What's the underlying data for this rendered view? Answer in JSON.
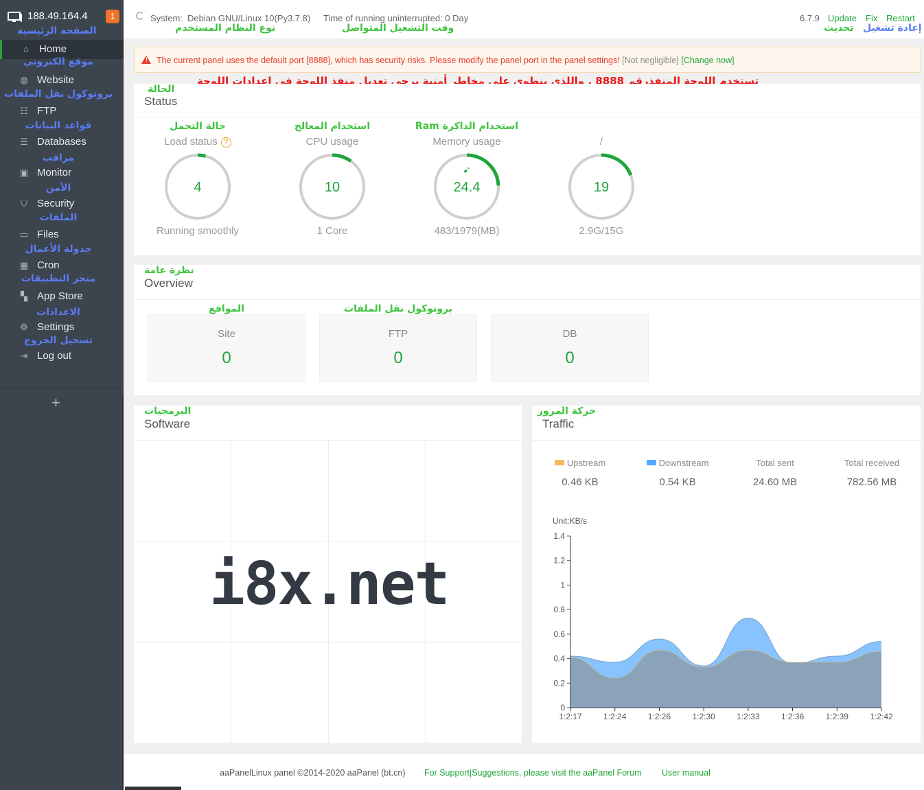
{
  "sidebar": {
    "ip": "188.49.164.4",
    "badge": "1",
    "home_ar": "الصفحة الرئيسية",
    "items": [
      {
        "label": "Home",
        "ar": "موقع الكتروني",
        "icon": "home-icon"
      },
      {
        "label": "Website",
        "ar": "بروتوكول نقل الملفات",
        "icon": "globe-icon"
      },
      {
        "label": "FTP",
        "ar": "قواعد البيانات",
        "icon": "ftp-icon"
      },
      {
        "label": "Databases",
        "ar": "مراقب",
        "icon": "database-icon"
      },
      {
        "label": "Monitor",
        "ar": "الأمن",
        "icon": "monitor-icon"
      },
      {
        "label": "Security",
        "ar": "الملفات",
        "icon": "shield-icon"
      },
      {
        "label": "Files",
        "ar": "جدولة الأعمال",
        "icon": "folder-icon"
      },
      {
        "label": "Cron",
        "ar": "متجر التطبيقات",
        "icon": "calendar-icon"
      },
      {
        "label": "App Store",
        "ar": "الاعدادات",
        "icon": "grid-icon"
      },
      {
        "label": "Settings",
        "ar": "تسجيل الخروج",
        "icon": "gear-icon"
      },
      {
        "label": "Log out",
        "ar": "",
        "icon": "logout-icon"
      }
    ],
    "add": "+"
  },
  "topbar": {
    "system_label": "System:",
    "system_value": "Debian GNU/Linux 10(Py3.7.8)",
    "system_ar": "نوع النظام المستخدم",
    "uptime": "Time of running uninterrupted: 0 Day",
    "uptime_ar": "وقت التشغيل المتواصل",
    "version": "6.7.9",
    "update": "Update",
    "fix": "Fix",
    "restart": "Restart",
    "update_ar": "تحديث",
    "restart_ar": "إعادة تشغيل"
  },
  "warning": {
    "message": "The current panel uses the default port [8888], which has security risks. Please modify the panel port in the panel settings!",
    "not_negligible": "[Not negligible]",
    "change_now": "[Change now]",
    "ar": "تستخدم اللوحة المنفذرقم 8888 , واللذي ينطوي على مخاطر أمنية يرجى تعديل منفذ اللوحة في اعدادات اللوحة"
  },
  "status": {
    "title": "Status",
    "title_ar": "الحالة",
    "gauges": [
      {
        "title": "Load status",
        "ar": "حالة التحمل",
        "value": "4",
        "percent": 4,
        "bottom": "Running smoothly"
      },
      {
        "title": "CPU usage",
        "ar": "استخدام المعالج",
        "value": "10",
        "percent": 10,
        "bottom": "1 Core"
      },
      {
        "title": "Memory usage",
        "ar": "استخدام الذاكرة Ram",
        "value": "24.4",
        "percent": 24.4,
        "bottom": "483/1979(MB)"
      },
      {
        "title": "/",
        "ar": "",
        "value": "19",
        "percent": 19,
        "bottom": "2.9G/15G"
      }
    ]
  },
  "overview": {
    "title": "Overview",
    "title_ar": "نظرة عامة",
    "cards": [
      {
        "label": "Site",
        "value": "0",
        "ar": "المواقع"
      },
      {
        "label": "FTP",
        "value": "0",
        "ar": "بروتوكول نقل الملفات"
      },
      {
        "label": "DB",
        "value": "0",
        "ar": ""
      }
    ]
  },
  "software": {
    "title": "Software",
    "title_ar": "البرمجيات",
    "watermark": "i8x.net"
  },
  "traffic": {
    "title": "Traffic",
    "title_ar": "حركة المرور",
    "stats": [
      {
        "label": "Upstream",
        "value": "0.46 KB",
        "color": "#f5b85a"
      },
      {
        "label": "Downstream",
        "value": "0.54 KB",
        "color": "#52a9ff"
      },
      {
        "label": "Total sent",
        "value": "24.60 MB"
      },
      {
        "label": "Total received",
        "value": "782.56 MB"
      }
    ]
  },
  "chart_data": {
    "type": "area",
    "ylabel": "Unit:KB/s",
    "ylim": [
      0,
      1.4
    ],
    "yticks": [
      "0",
      "0.2",
      "0.4",
      "0.6",
      "0.8",
      "1",
      "1.2",
      "1.4"
    ],
    "xlabels": [
      "1:2:17",
      "1:2:24",
      "1:2:26",
      "1:2:30",
      "1:2:33",
      "1:2:36",
      "1:2:39",
      "1:2:42"
    ],
    "series": [
      {
        "name": "Upstream",
        "color": "#f5b85a",
        "values": [
          0.41,
          0.24,
          0.47,
          0.33,
          0.47,
          0.37,
          0.37,
          0.46
        ]
      },
      {
        "name": "Downstream",
        "color": "#52a9ff",
        "values": [
          0.42,
          0.37,
          0.56,
          0.34,
          0.73,
          0.36,
          0.42,
          0.54
        ]
      }
    ]
  },
  "footer": {
    "copyright": "aaPanelLinux panel ©2014-2020 aaPanel (bt.cn)",
    "support": "For Support|Suggestions, please visit the aaPanel Forum",
    "manual": "User manual"
  },
  "colors": {
    "accent": "#20a53a",
    "sidebar": "#3c444d",
    "warning": "#e8382c"
  }
}
